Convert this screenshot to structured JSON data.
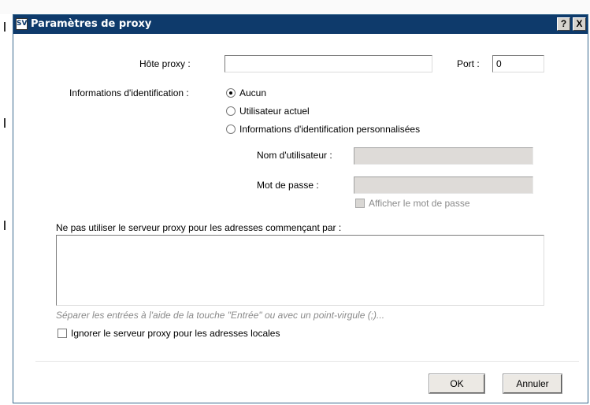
{
  "window": {
    "title": "Paramètres de proxy",
    "icon_text": "SV",
    "help_label": "?",
    "close_label": "X"
  },
  "proxy": {
    "host_label": "Hôte proxy :",
    "host_value": "",
    "port_label": "Port :",
    "port_value": "0"
  },
  "credentials": {
    "label": "Informations d'identification :",
    "options": [
      {
        "label": "Aucun",
        "selected": true
      },
      {
        "label": "Utilisateur actuel",
        "selected": false
      },
      {
        "label": "Informations d'identification personnalisées",
        "selected": false
      }
    ],
    "username_label": "Nom d'utilisateur :",
    "username_value": "",
    "password_label": "Mot de passe :",
    "password_value": "",
    "show_password_label": "Afficher le mot de passe"
  },
  "bypass": {
    "label": "Ne pas utiliser le serveur proxy pour les adresses commençant par :",
    "value": "",
    "hint": "Séparer les entrées à l'aide de la touche \"Entrée\" ou avec un point-virgule (;)...",
    "ignore_local_label": "Ignorer le serveur proxy pour les adresses locales"
  },
  "buttons": {
    "ok": "OK",
    "cancel": "Annuler"
  }
}
